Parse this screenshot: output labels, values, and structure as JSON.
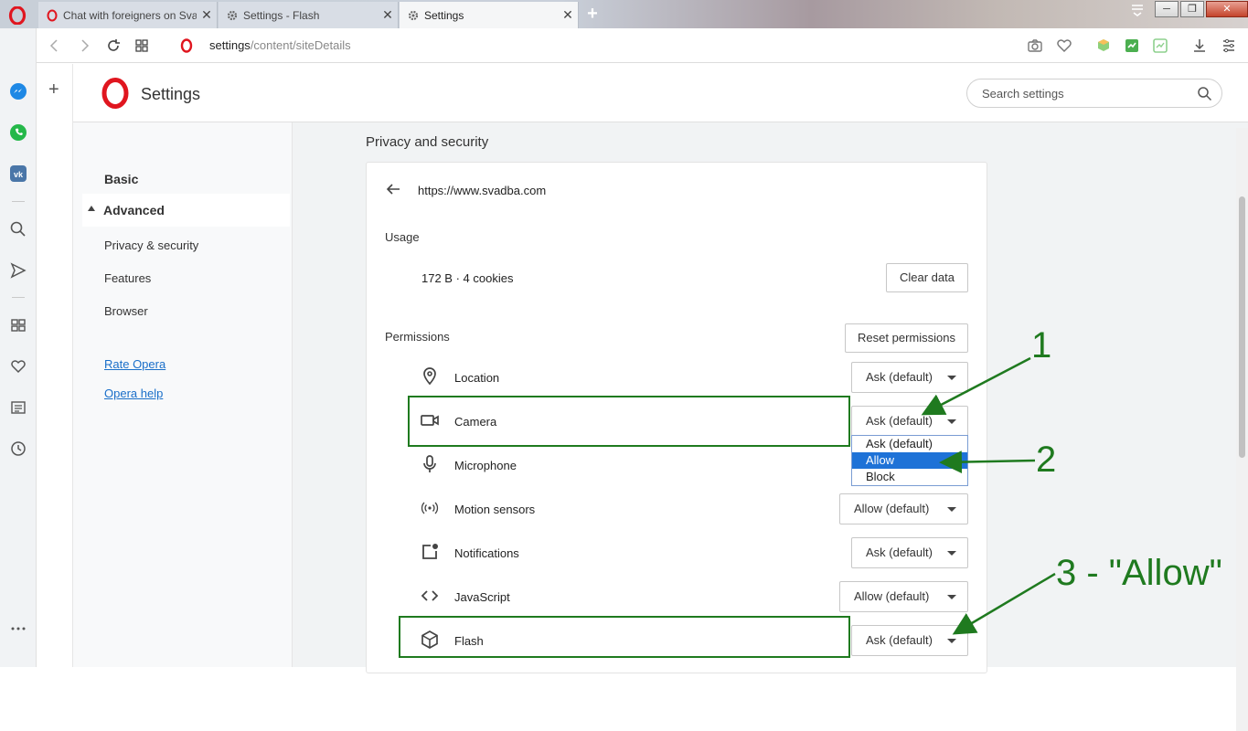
{
  "tabs": [
    {
      "label": "Chat with foreigners on Sva",
      "icon": "opera-icon"
    },
    {
      "label": "Settings - Flash",
      "icon": "gear-icon"
    },
    {
      "label": "Settings",
      "icon": "gear-icon"
    }
  ],
  "tab_close": "✕",
  "new_tab": "+",
  "address": {
    "host": "settings",
    "path": "/content/siteDetails"
  },
  "header": {
    "title": "Settings",
    "search_placeholder": "Search settings"
  },
  "plus": "+",
  "nav": {
    "basic": "Basic",
    "advanced": "Advanced",
    "sub_items": [
      "Privacy & security",
      "Features",
      "Browser"
    ],
    "links": [
      "Rate Opera",
      "Opera help"
    ]
  },
  "section_title": "Privacy and security",
  "site": {
    "url": "https://www.svadba.com",
    "usage_heading": "Usage",
    "usage_value": "172 B · 4 cookies",
    "clear_data": "Clear data",
    "permissions_heading": "Permissions",
    "reset_permissions": "Reset permissions"
  },
  "permissions": [
    {
      "label": "Location",
      "value": "Ask (default)"
    },
    {
      "label": "Camera",
      "value": "Ask (default)"
    },
    {
      "label": "Microphone",
      "value": ""
    },
    {
      "label": "Motion sensors",
      "value": "Allow (default)"
    },
    {
      "label": "Notifications",
      "value": "Ask (default)"
    },
    {
      "label": "JavaScript",
      "value": "Allow (default)"
    },
    {
      "label": "Flash",
      "value": "Ask (default)"
    }
  ],
  "dropdown_options": [
    "Ask (default)",
    "Allow",
    "Block"
  ],
  "dropdown_selected": "Allow",
  "annotations": [
    "1",
    "2",
    "3 - \"Allow\""
  ],
  "colors": {
    "annotation": "#1f7a1f",
    "selection": "#1e72d7",
    "link": "#1a6fc9",
    "opera_red": "#e0161f"
  }
}
